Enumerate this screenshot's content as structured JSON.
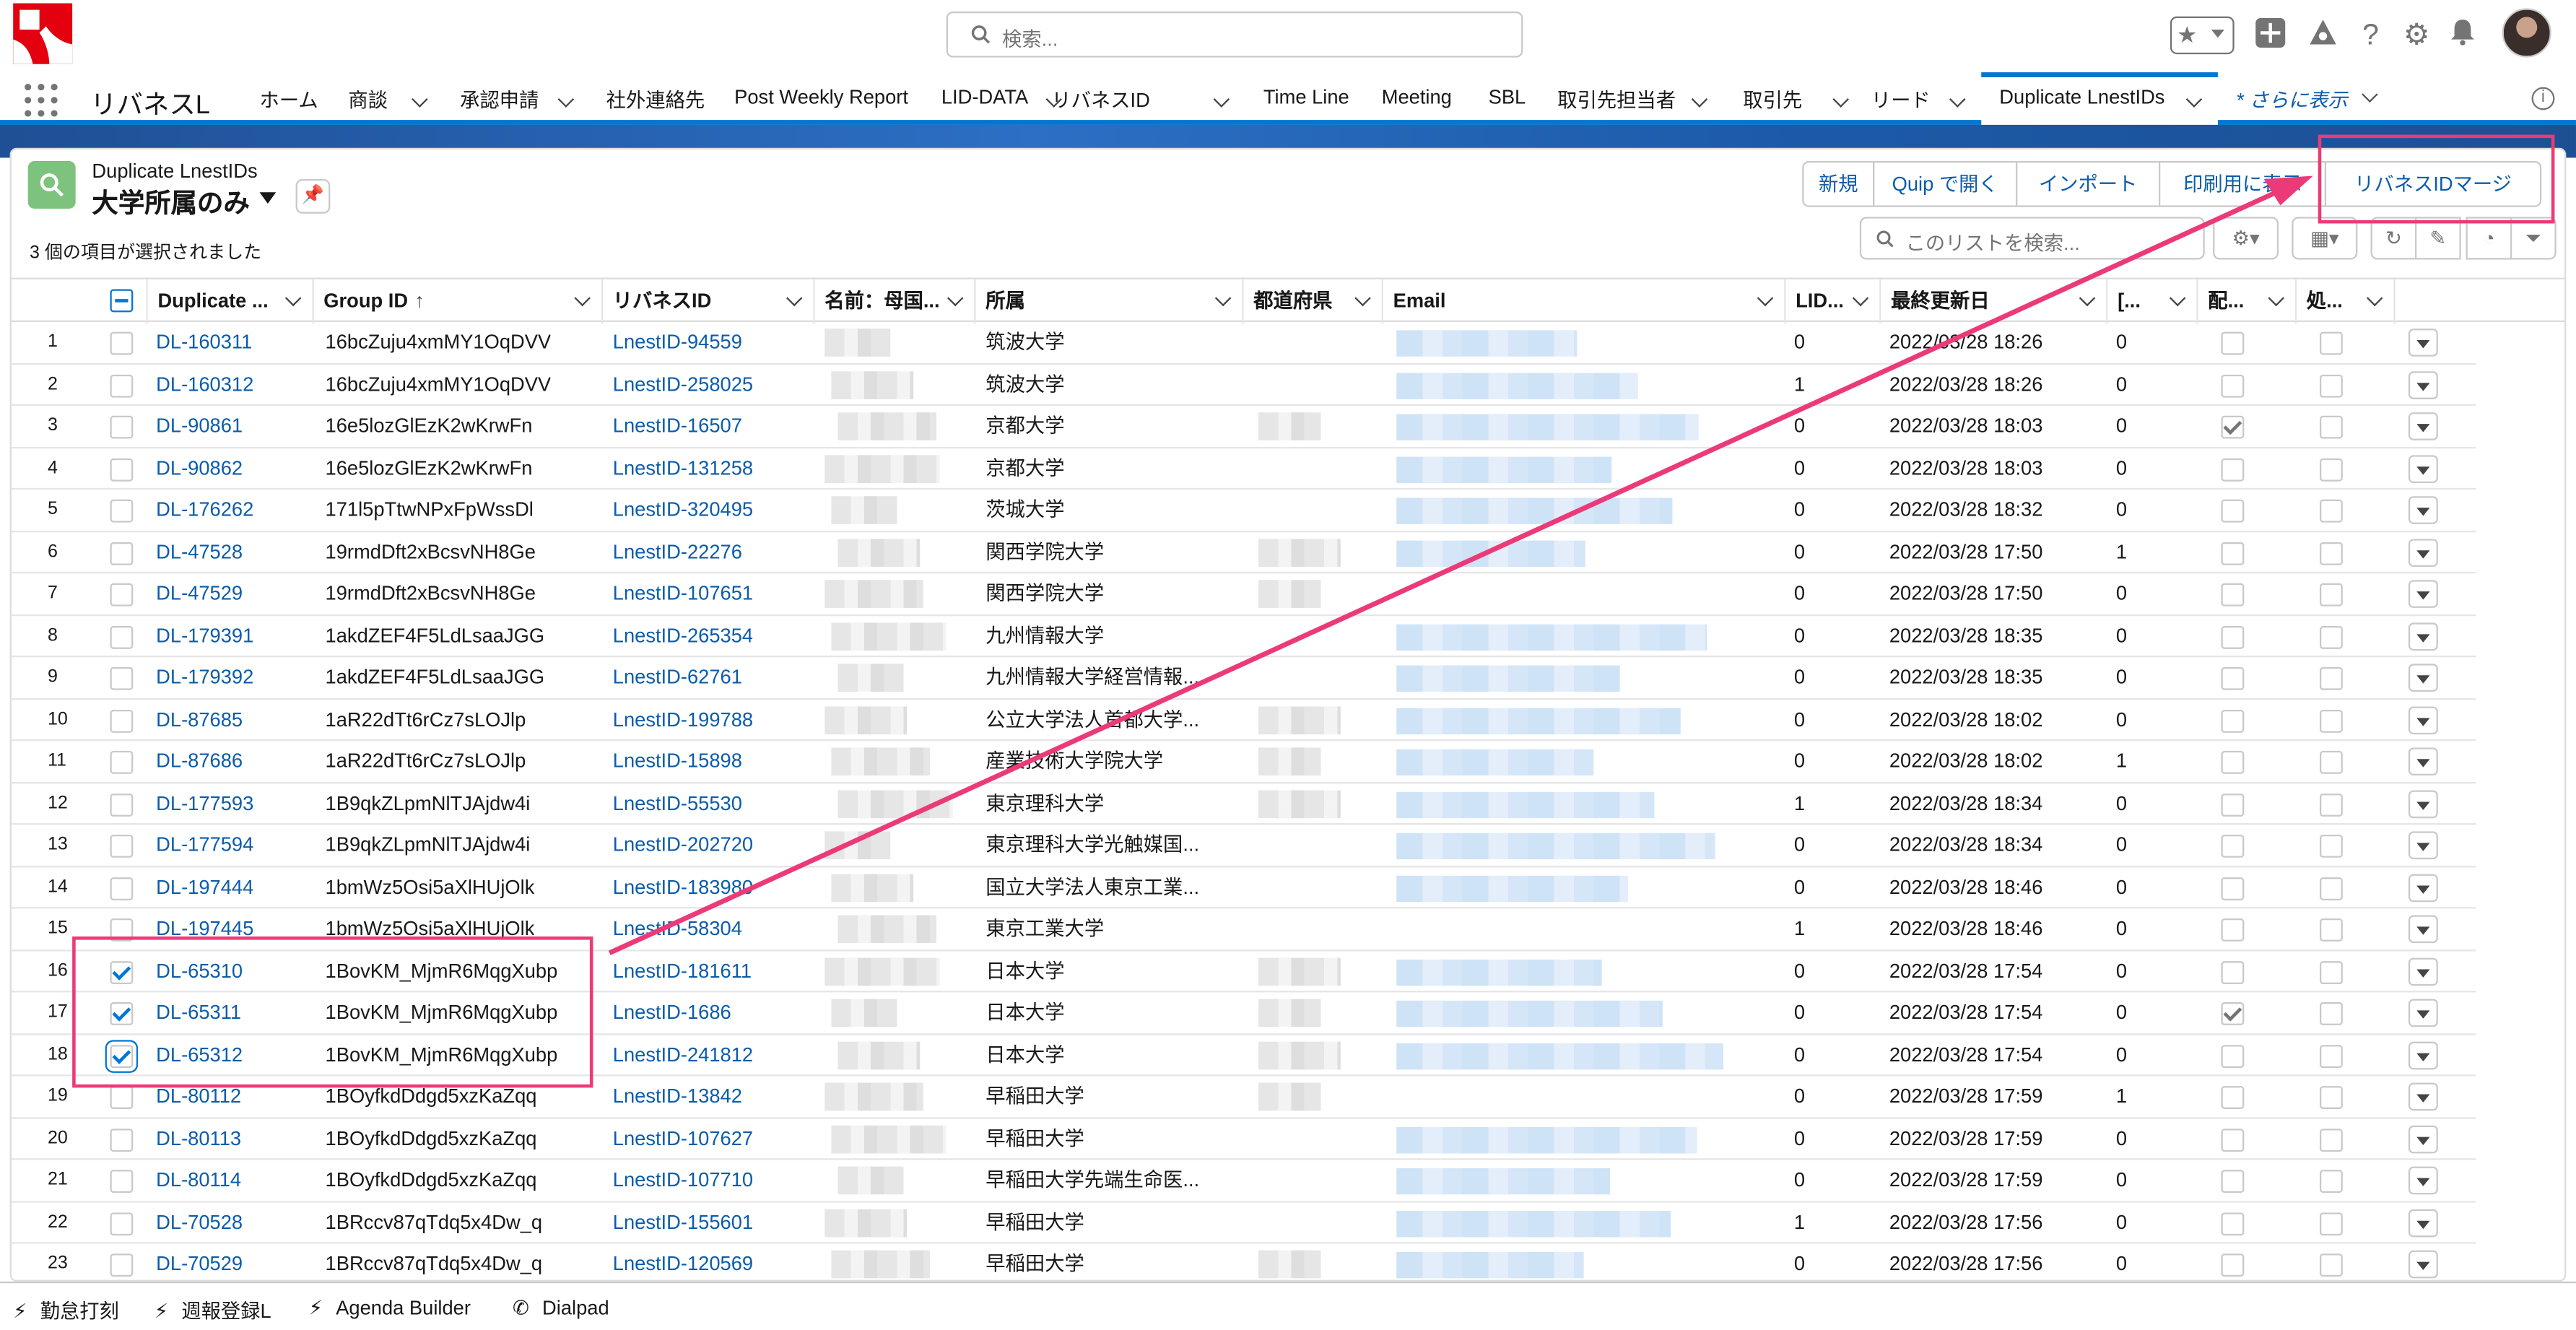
{
  "header": {
    "search_placeholder": "検索...",
    "icons": [
      "favorites-star-icon",
      "add-icon",
      "trailhead-icon",
      "help-icon",
      "setup-gear-icon",
      "notifications-bell-icon"
    ]
  },
  "nav": {
    "app_name": "リバネスL",
    "items": [
      {
        "label": "ホーム",
        "chevron": false
      },
      {
        "label": "商談",
        "chevron": true
      },
      {
        "label": "承認申請",
        "chevron": true
      },
      {
        "label": "社外連絡先",
        "chevron": false
      },
      {
        "label": "Post Weekly Report",
        "chevron": false
      },
      {
        "label": "LID-DATA",
        "chevron": true
      },
      {
        "label": "リバネスID",
        "chevron": true
      },
      {
        "label": "Time Line",
        "chevron": false
      },
      {
        "label": "Meeting",
        "chevron": false
      },
      {
        "label": "SBL",
        "chevron": false
      },
      {
        "label": "取引先担当者",
        "chevron": true
      },
      {
        "label": "取引先",
        "chevron": true
      },
      {
        "label": "リード",
        "chevron": true
      },
      {
        "label": "Duplicate LnestIDs",
        "chevron": true,
        "active": true
      }
    ],
    "more_label": "* さらに表示"
  },
  "list": {
    "object_type": "Duplicate LnestIDs",
    "view_name": "大学所属のみ",
    "selected_text": "3 個の項目が選択されました",
    "search_placeholder": "このリストを検索...",
    "buttons": [
      "新規",
      "Quip で開く",
      "インポート",
      "印刷用に表示",
      "リバネスIDマージ"
    ],
    "columns": [
      "Duplicate ...",
      "Group ID",
      "リバネスID",
      "名前：母国...",
      "所属",
      "都道府県",
      "Email",
      "LID...",
      "最終更新日",
      "[...",
      "配...",
      "処..."
    ],
    "sort_indicator": "↑"
  },
  "rows": [
    {
      "n": "1",
      "dl": "DL-160311",
      "gid": "16bcZuju4xmMY1OqDVV",
      "lid": "LnestID-94559",
      "org": "筑波大学",
      "lidn": "0",
      "date": "2022/03/28 18:26",
      "b": "0",
      "c1": false,
      "c2": false,
      "sel": false
    },
    {
      "n": "2",
      "dl": "DL-160312",
      "gid": "16bcZuju4xmMY1OqDVV",
      "lid": "LnestID-258025",
      "org": "筑波大学",
      "lidn": "1",
      "date": "2022/03/28 18:26",
      "b": "0",
      "c1": false,
      "c2": false,
      "sel": false
    },
    {
      "n": "3",
      "dl": "DL-90861",
      "gid": "16e5lozGlEzK2wKrwFn",
      "lid": "LnestID-16507",
      "org": "京都大学",
      "lidn": "0",
      "date": "2022/03/28 18:03",
      "b": "0",
      "c1": true,
      "c2": false,
      "sel": false
    },
    {
      "n": "4",
      "dl": "DL-90862",
      "gid": "16e5lozGlEzK2wKrwFn",
      "lid": "LnestID-131258",
      "org": "京都大学",
      "lidn": "0",
      "date": "2022/03/28 18:03",
      "b": "0",
      "c1": false,
      "c2": false,
      "sel": false
    },
    {
      "n": "5",
      "dl": "DL-176262",
      "gid": "171l5pTtwNPxFpWssDl",
      "lid": "LnestID-320495",
      "org": "茨城大学",
      "lidn": "0",
      "date": "2022/03/28 18:32",
      "b": "0",
      "c1": false,
      "c2": false,
      "sel": false
    },
    {
      "n": "6",
      "dl": "DL-47528",
      "gid": "19rmdDft2xBcsvNH8Ge",
      "lid": "LnestID-22276",
      "org": "関西学院大学",
      "lidn": "0",
      "date": "2022/03/28 17:50",
      "b": "1",
      "c1": false,
      "c2": false,
      "sel": false
    },
    {
      "n": "7",
      "dl": "DL-47529",
      "gid": "19rmdDft2xBcsvNH8Ge",
      "lid": "LnestID-107651",
      "org": "関西学院大学",
      "lidn": "0",
      "date": "2022/03/28 17:50",
      "b": "0",
      "c1": false,
      "c2": false,
      "sel": false
    },
    {
      "n": "8",
      "dl": "DL-179391",
      "gid": "1akdZEF4F5LdLsaaJGG",
      "lid": "LnestID-265354",
      "org": "九州情報大学",
      "lidn": "0",
      "date": "2022/03/28 18:35",
      "b": "0",
      "c1": false,
      "c2": false,
      "sel": false
    },
    {
      "n": "9",
      "dl": "DL-179392",
      "gid": "1akdZEF4F5LdLsaaJGG",
      "lid": "LnestID-62761",
      "org": "九州情報大学経営情報...",
      "lidn": "0",
      "date": "2022/03/28 18:35",
      "b": "0",
      "c1": false,
      "c2": false,
      "sel": false
    },
    {
      "n": "10",
      "dl": "DL-87685",
      "gid": "1aR22dTt6rCz7sLOJlp",
      "lid": "LnestID-199788",
      "org": "公立大学法人首都大学...",
      "lidn": "0",
      "date": "2022/03/28 18:02",
      "b": "0",
      "c1": false,
      "c2": false,
      "sel": false
    },
    {
      "n": "11",
      "dl": "DL-87686",
      "gid": "1aR22dTt6rCz7sLOJlp",
      "lid": "LnestID-15898",
      "org": "産業技術大学院大学",
      "lidn": "0",
      "date": "2022/03/28 18:02",
      "b": "1",
      "c1": false,
      "c2": false,
      "sel": false
    },
    {
      "n": "12",
      "dl": "DL-177593",
      "gid": "1B9qkZLpmNlTJAjdw4i",
      "lid": "LnestID-55530",
      "org": "東京理科大学",
      "lidn": "1",
      "date": "2022/03/28 18:34",
      "b": "0",
      "c1": false,
      "c2": false,
      "sel": false
    },
    {
      "n": "13",
      "dl": "DL-177594",
      "gid": "1B9qkZLpmNlTJAjdw4i",
      "lid": "LnestID-202720",
      "org": "東京理科大学光触媒国...",
      "lidn": "0",
      "date": "2022/03/28 18:34",
      "b": "0",
      "c1": false,
      "c2": false,
      "sel": false
    },
    {
      "n": "14",
      "dl": "DL-197444",
      "gid": "1bmWz5Osi5aXlHUjOlk",
      "lid": "LnestID-183980",
      "org": "国立大学法人東京工業...",
      "lidn": "0",
      "date": "2022/03/28 18:46",
      "b": "0",
      "c1": false,
      "c2": false,
      "sel": false
    },
    {
      "n": "15",
      "dl": "DL-197445",
      "gid": "1bmWz5Osi5aXlHUjOlk",
      "lid": "LnestID-58304",
      "org": "東京工業大学",
      "lidn": "1",
      "date": "2022/03/28 18:46",
      "b": "0",
      "c1": false,
      "c2": false,
      "sel": false
    },
    {
      "n": "16",
      "dl": "DL-65310",
      "gid": "1BovKM_MjmR6MqgXubp",
      "lid": "LnestID-181611",
      "org": "日本大学",
      "lidn": "0",
      "date": "2022/03/28 17:54",
      "b": "0",
      "c1": false,
      "c2": false,
      "sel": true
    },
    {
      "n": "17",
      "dl": "DL-65311",
      "gid": "1BovKM_MjmR6MqgXubp",
      "lid": "LnestID-1686",
      "org": "日本大学",
      "lidn": "0",
      "date": "2022/03/28 17:54",
      "b": "0",
      "c1": true,
      "c2": false,
      "sel": true
    },
    {
      "n": "18",
      "dl": "DL-65312",
      "gid": "1BovKM_MjmR6MqgXubp",
      "lid": "LnestID-241812",
      "org": "日本大学",
      "lidn": "0",
      "date": "2022/03/28 17:54",
      "b": "0",
      "c1": false,
      "c2": false,
      "sel": true
    },
    {
      "n": "19",
      "dl": "DL-80112",
      "gid": "1BOyfkdDdgd5xzKaZqq",
      "lid": "LnestID-13842",
      "org": "早稲田大学",
      "lidn": "0",
      "date": "2022/03/28 17:59",
      "b": "1",
      "c1": false,
      "c2": false,
      "sel": false
    },
    {
      "n": "20",
      "dl": "DL-80113",
      "gid": "1BOyfkdDdgd5xzKaZqq",
      "lid": "LnestID-107627",
      "org": "早稲田大学",
      "lidn": "0",
      "date": "2022/03/28 17:59",
      "b": "0",
      "c1": false,
      "c2": false,
      "sel": false
    },
    {
      "n": "21",
      "dl": "DL-80114",
      "gid": "1BOyfkdDdgd5xzKaZqq",
      "lid": "LnestID-107710",
      "org": "早稲田大学先端生命医...",
      "lidn": "0",
      "date": "2022/03/28 17:59",
      "b": "0",
      "c1": false,
      "c2": false,
      "sel": false
    },
    {
      "n": "22",
      "dl": "DL-70528",
      "gid": "1BRccv87qTdq5x4Dw_q",
      "lid": "LnestID-155601",
      "org": "早稲田大学",
      "lidn": "1",
      "date": "2022/03/28 17:56",
      "b": "0",
      "c1": false,
      "c2": false,
      "sel": false
    },
    {
      "n": "23",
      "dl": "DL-70529",
      "gid": "1BRccv87qTdq5x4Dw_q",
      "lid": "LnestID-120569",
      "org": "早稲田大学",
      "lidn": "0",
      "date": "2022/03/28 17:56",
      "b": "0",
      "c1": false,
      "c2": false,
      "sel": false
    }
  ],
  "utility_bar": [
    "勤怠打刻",
    "週報登録L",
    "Agenda Builder",
    "Dialpad"
  ],
  "colors": {
    "brand_red": "#e3000f",
    "link": "#0b5cab",
    "accent_blue": "#0176d3",
    "annotation_pink": "#ec3a78"
  }
}
